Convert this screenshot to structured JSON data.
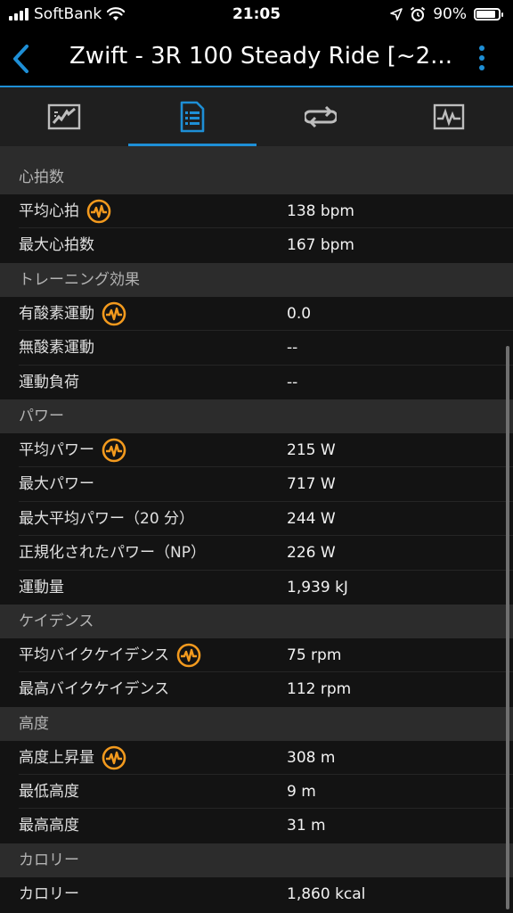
{
  "status_bar": {
    "carrier": "SoftBank",
    "time": "21:05",
    "battery": "90%",
    "battery_level": 0.9
  },
  "nav": {
    "title": "Zwift - 3R 100 Steady Ride [~2...",
    "back_icon": "chevron-left-icon",
    "more_icon": "more-vertical-icon",
    "accent_color": "#1e8fd6"
  },
  "tabs": [
    {
      "icon": "map-chart-icon",
      "active": false
    },
    {
      "icon": "document-list-icon",
      "active": true
    },
    {
      "icon": "laps-repeat-icon",
      "active": false
    },
    {
      "icon": "activity-graph-icon",
      "active": false
    }
  ],
  "sections": [
    {
      "title": "心拍数",
      "rows": [
        {
          "label": "平均心拍",
          "value": "138 bpm",
          "badge": true
        },
        {
          "label": "最大心拍数",
          "value": "167 bpm",
          "badge": false
        }
      ]
    },
    {
      "title": "トレーニング効果",
      "rows": [
        {
          "label": "有酸素運動",
          "value": "0.0",
          "badge": true
        },
        {
          "label": "無酸素運動",
          "value": "--",
          "badge": false
        },
        {
          "label": "運動負荷",
          "value": "--",
          "badge": false
        }
      ]
    },
    {
      "title": "パワー",
      "rows": [
        {
          "label": "平均パワー",
          "value": "215 W",
          "badge": true
        },
        {
          "label": "最大パワー",
          "value": "717 W",
          "badge": false
        },
        {
          "label": "最大平均パワー（20 分）",
          "value": "244 W",
          "badge": false
        },
        {
          "label": "正規化されたパワー（NP）",
          "value": "226 W",
          "badge": false
        },
        {
          "label": "運動量",
          "value": "1,939 kJ",
          "badge": false
        }
      ]
    },
    {
      "title": "ケイデンス",
      "rows": [
        {
          "label": "平均バイクケイデンス",
          "value": "75 rpm",
          "badge": true
        },
        {
          "label": "最高バイクケイデンス",
          "value": "112 rpm",
          "badge": false
        }
      ]
    },
    {
      "title": "高度",
      "rows": [
        {
          "label": "高度上昇量",
          "value": "308 m",
          "badge": true
        },
        {
          "label": "最低高度",
          "value": "9 m",
          "badge": false
        },
        {
          "label": "最高高度",
          "value": "31 m",
          "badge": false
        }
      ]
    },
    {
      "title": "カロリー",
      "rows": [
        {
          "label": "カロリー",
          "value": "1,860 kcal",
          "badge": false
        }
      ]
    }
  ],
  "badge_icon": "heart-pulse-badge-icon",
  "badge_color": "#f39a1e"
}
